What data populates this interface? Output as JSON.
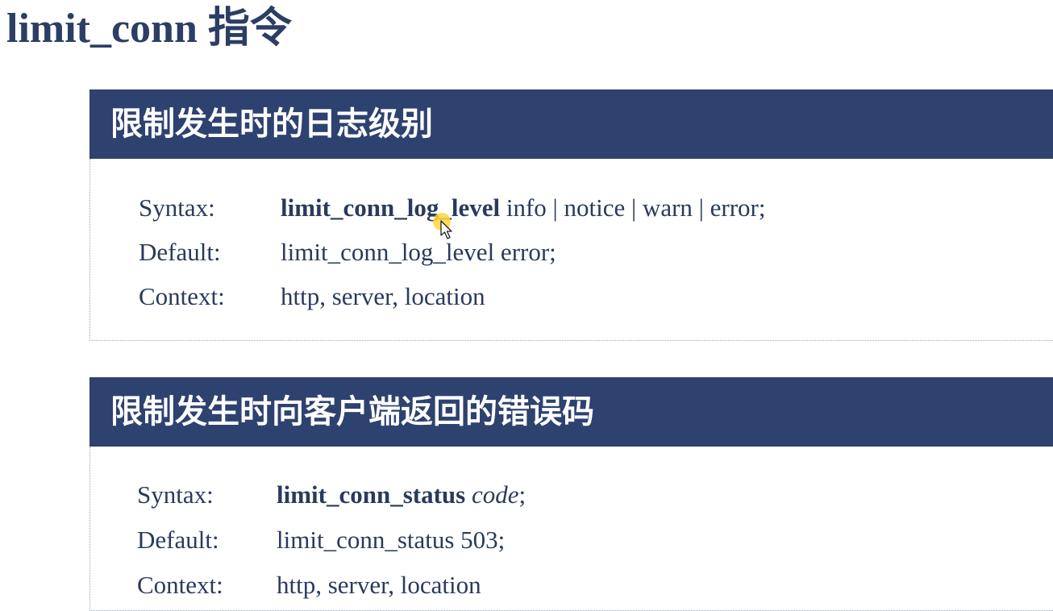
{
  "page": {
    "title": "limit_conn 指令"
  },
  "sections": [
    {
      "header": "限制发生时的日志级别",
      "rows": [
        {
          "label": "Syntax:",
          "directive": "limit_conn_log_level",
          "rest": " info | notice | warn | error;"
        },
        {
          "label": "Default:",
          "value": "limit_conn_log_level error;"
        },
        {
          "label": "Context:",
          "value": "http, server, location"
        }
      ]
    },
    {
      "header": "限制发生时向客户端返回的错误码",
      "rows": [
        {
          "label": "Syntax:",
          "directive": "limit_conn_status",
          "param": "code",
          "rest": ";"
        },
        {
          "label": "Default:",
          "value": "limit_conn_status 503;"
        },
        {
          "label": "Context:",
          "value": "http, server, location"
        }
      ]
    }
  ],
  "colors": {
    "header_bg": "#2e4270",
    "text": "#2a3a5c",
    "cursor_highlight": "#ffd63c"
  }
}
